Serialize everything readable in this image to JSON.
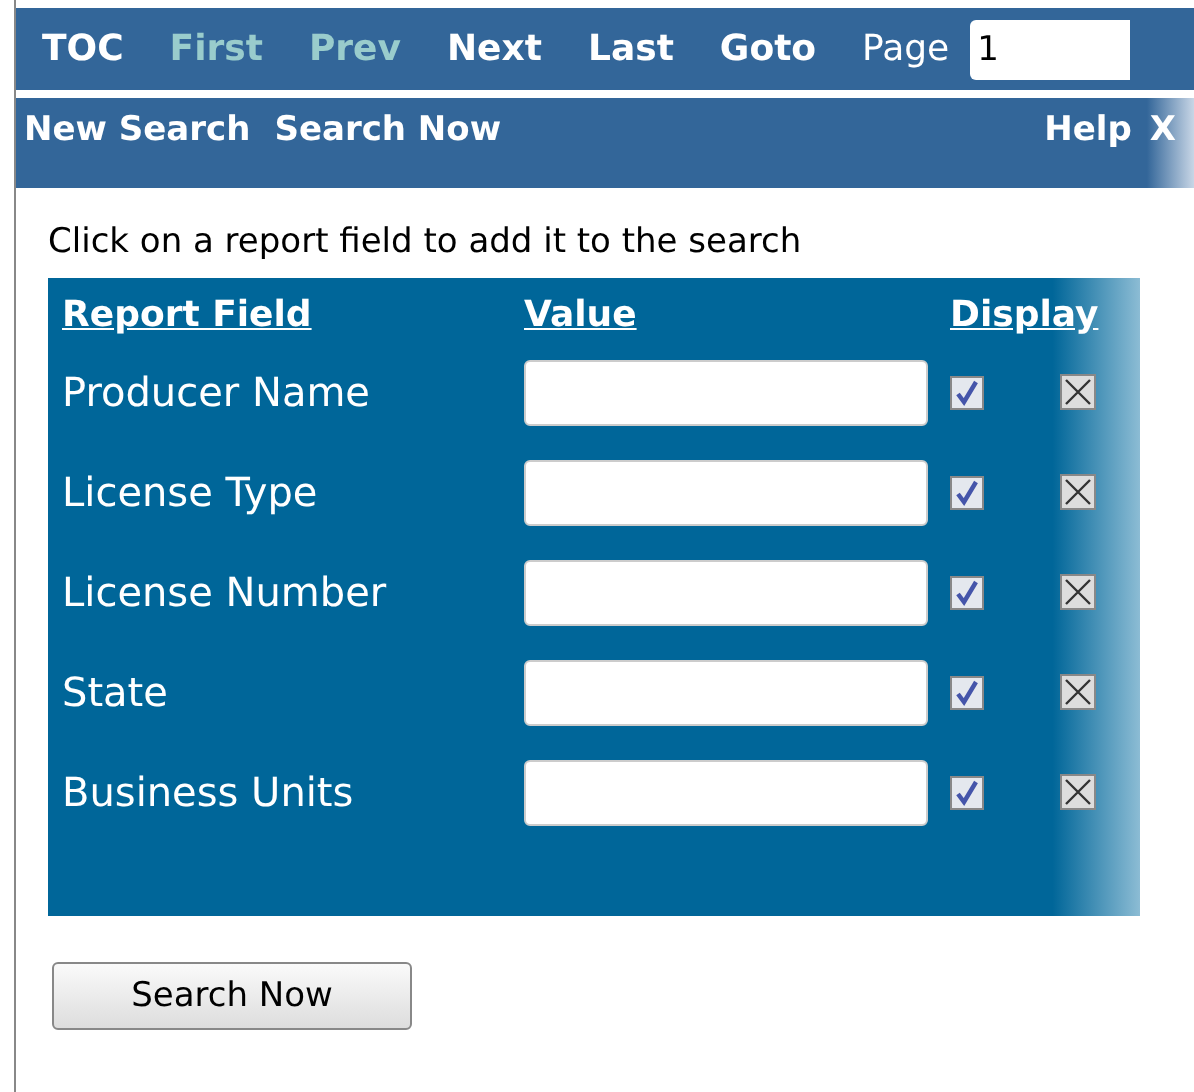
{
  "nav": {
    "items": [
      {
        "label": "TOC",
        "disabled": false
      },
      {
        "label": "First",
        "disabled": true
      },
      {
        "label": "Prev",
        "disabled": true
      },
      {
        "label": "Next",
        "disabled": false
      },
      {
        "label": "Last",
        "disabled": false
      },
      {
        "label": "Goto",
        "disabled": false
      }
    ],
    "page_label": "Page",
    "page_value": "1"
  },
  "toolbar": {
    "left": [
      "New Search",
      "Search Now"
    ],
    "right": [
      "Help",
      "X"
    ]
  },
  "instructions": "Click on a report field to add it to the search",
  "table": {
    "columns": [
      "Report Field",
      "Value",
      "Display"
    ],
    "rows": [
      {
        "field": "Producer Name",
        "display": true
      },
      {
        "field": "License Type",
        "display": true
      },
      {
        "field": "License Number",
        "display": true
      },
      {
        "field": "State",
        "display": true
      },
      {
        "field": "Business Units",
        "display": true
      }
    ]
  },
  "button": "Search Now"
}
